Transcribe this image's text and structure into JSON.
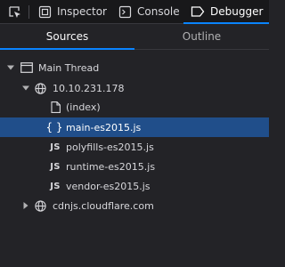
{
  "toolbar": {
    "picker_icon": "element-picker-icon",
    "tabs": [
      {
        "label": "Inspector",
        "icon": "inspector-icon"
      },
      {
        "label": "Console",
        "icon": "console-icon"
      },
      {
        "label": "Debugger",
        "icon": "debugger-icon",
        "selected": true
      }
    ]
  },
  "subtabs": [
    {
      "label": "Sources",
      "selected": true
    },
    {
      "label": "Outline"
    }
  ],
  "tree": {
    "thread": {
      "label": "Main Thread",
      "expanded": true,
      "icon": "window-icon"
    },
    "host1": {
      "label": "10.10.231.178",
      "expanded": true,
      "icon": "globe-icon"
    },
    "files": [
      {
        "label": "(index)",
        "icon": "file-icon"
      },
      {
        "label": "main-es2015.js",
        "icon": "braces-icon",
        "icon_text": "{ }",
        "selected": true
      },
      {
        "label": "polyfills-es2015.js",
        "icon": "js-icon",
        "icon_text": "JS"
      },
      {
        "label": "runtime-es2015.js",
        "icon": "js-icon",
        "icon_text": "JS"
      },
      {
        "label": "vendor-es2015.js",
        "icon": "js-icon",
        "icon_text": "JS"
      }
    ],
    "host2": {
      "label": "cdnjs.cloudflare.com",
      "expanded": false,
      "icon": "globe-icon"
    }
  },
  "colors": {
    "background": "#232327",
    "toolbar": "#18181a",
    "accent": "#0a84ff",
    "selection": "#204e8a"
  }
}
